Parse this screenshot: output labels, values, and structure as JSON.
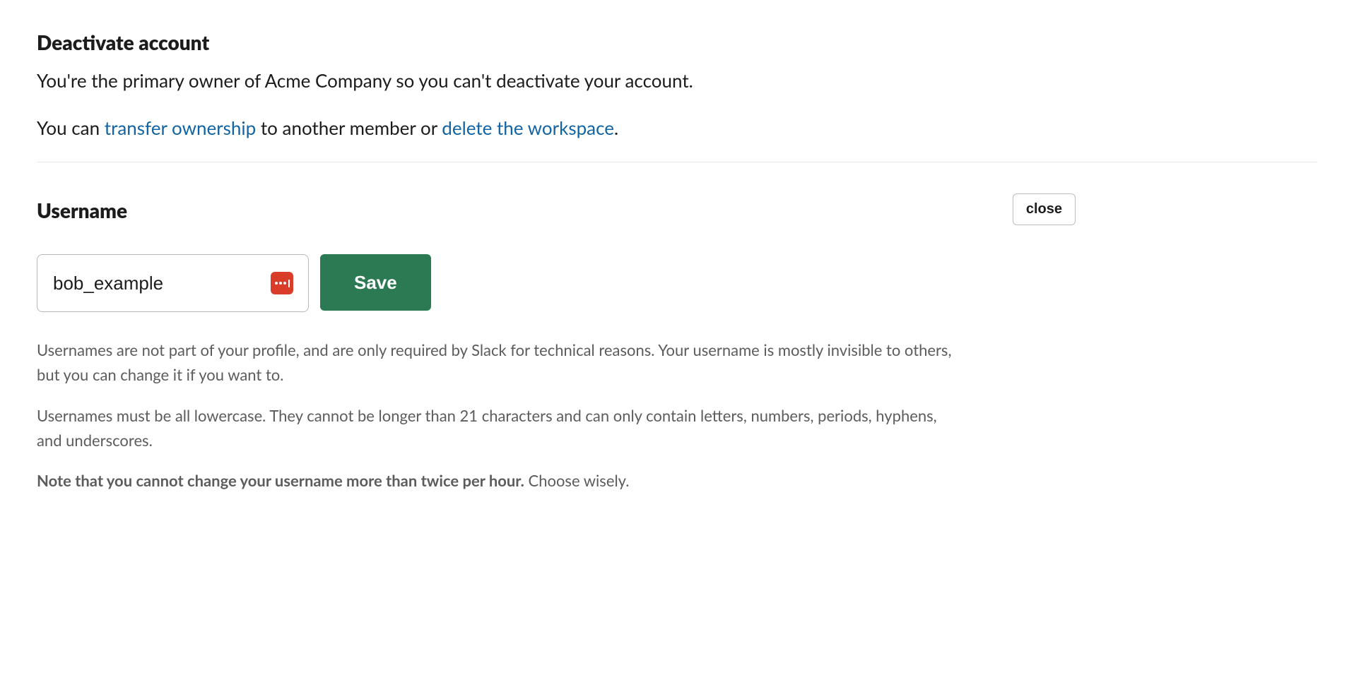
{
  "deactivate": {
    "title": "Deactivate account",
    "body_prefix": "You're the primary owner of Acme Company so you can't deactivate your account.",
    "body2_prefix": "You can ",
    "link_transfer": "transfer ownership",
    "body2_mid": " to another member or ",
    "link_delete": "delete the workspace",
    "body2_suffix": "."
  },
  "username": {
    "title": "Username",
    "close_label": "close",
    "value": "bob_example",
    "save_label": "Save",
    "help1": "Usernames are not part of your profile, and are only required by Slack for technical reasons. Your username is mostly invisible to others, but you can change it if you want to.",
    "help2": "Usernames must be all lowercase. They cannot be longer than 21 characters and can only contain letters, numbers, periods, hyphens, and underscores.",
    "help3_bold": "Note that you cannot change your username more than twice per hour.",
    "help3_rest": " Choose wisely."
  }
}
